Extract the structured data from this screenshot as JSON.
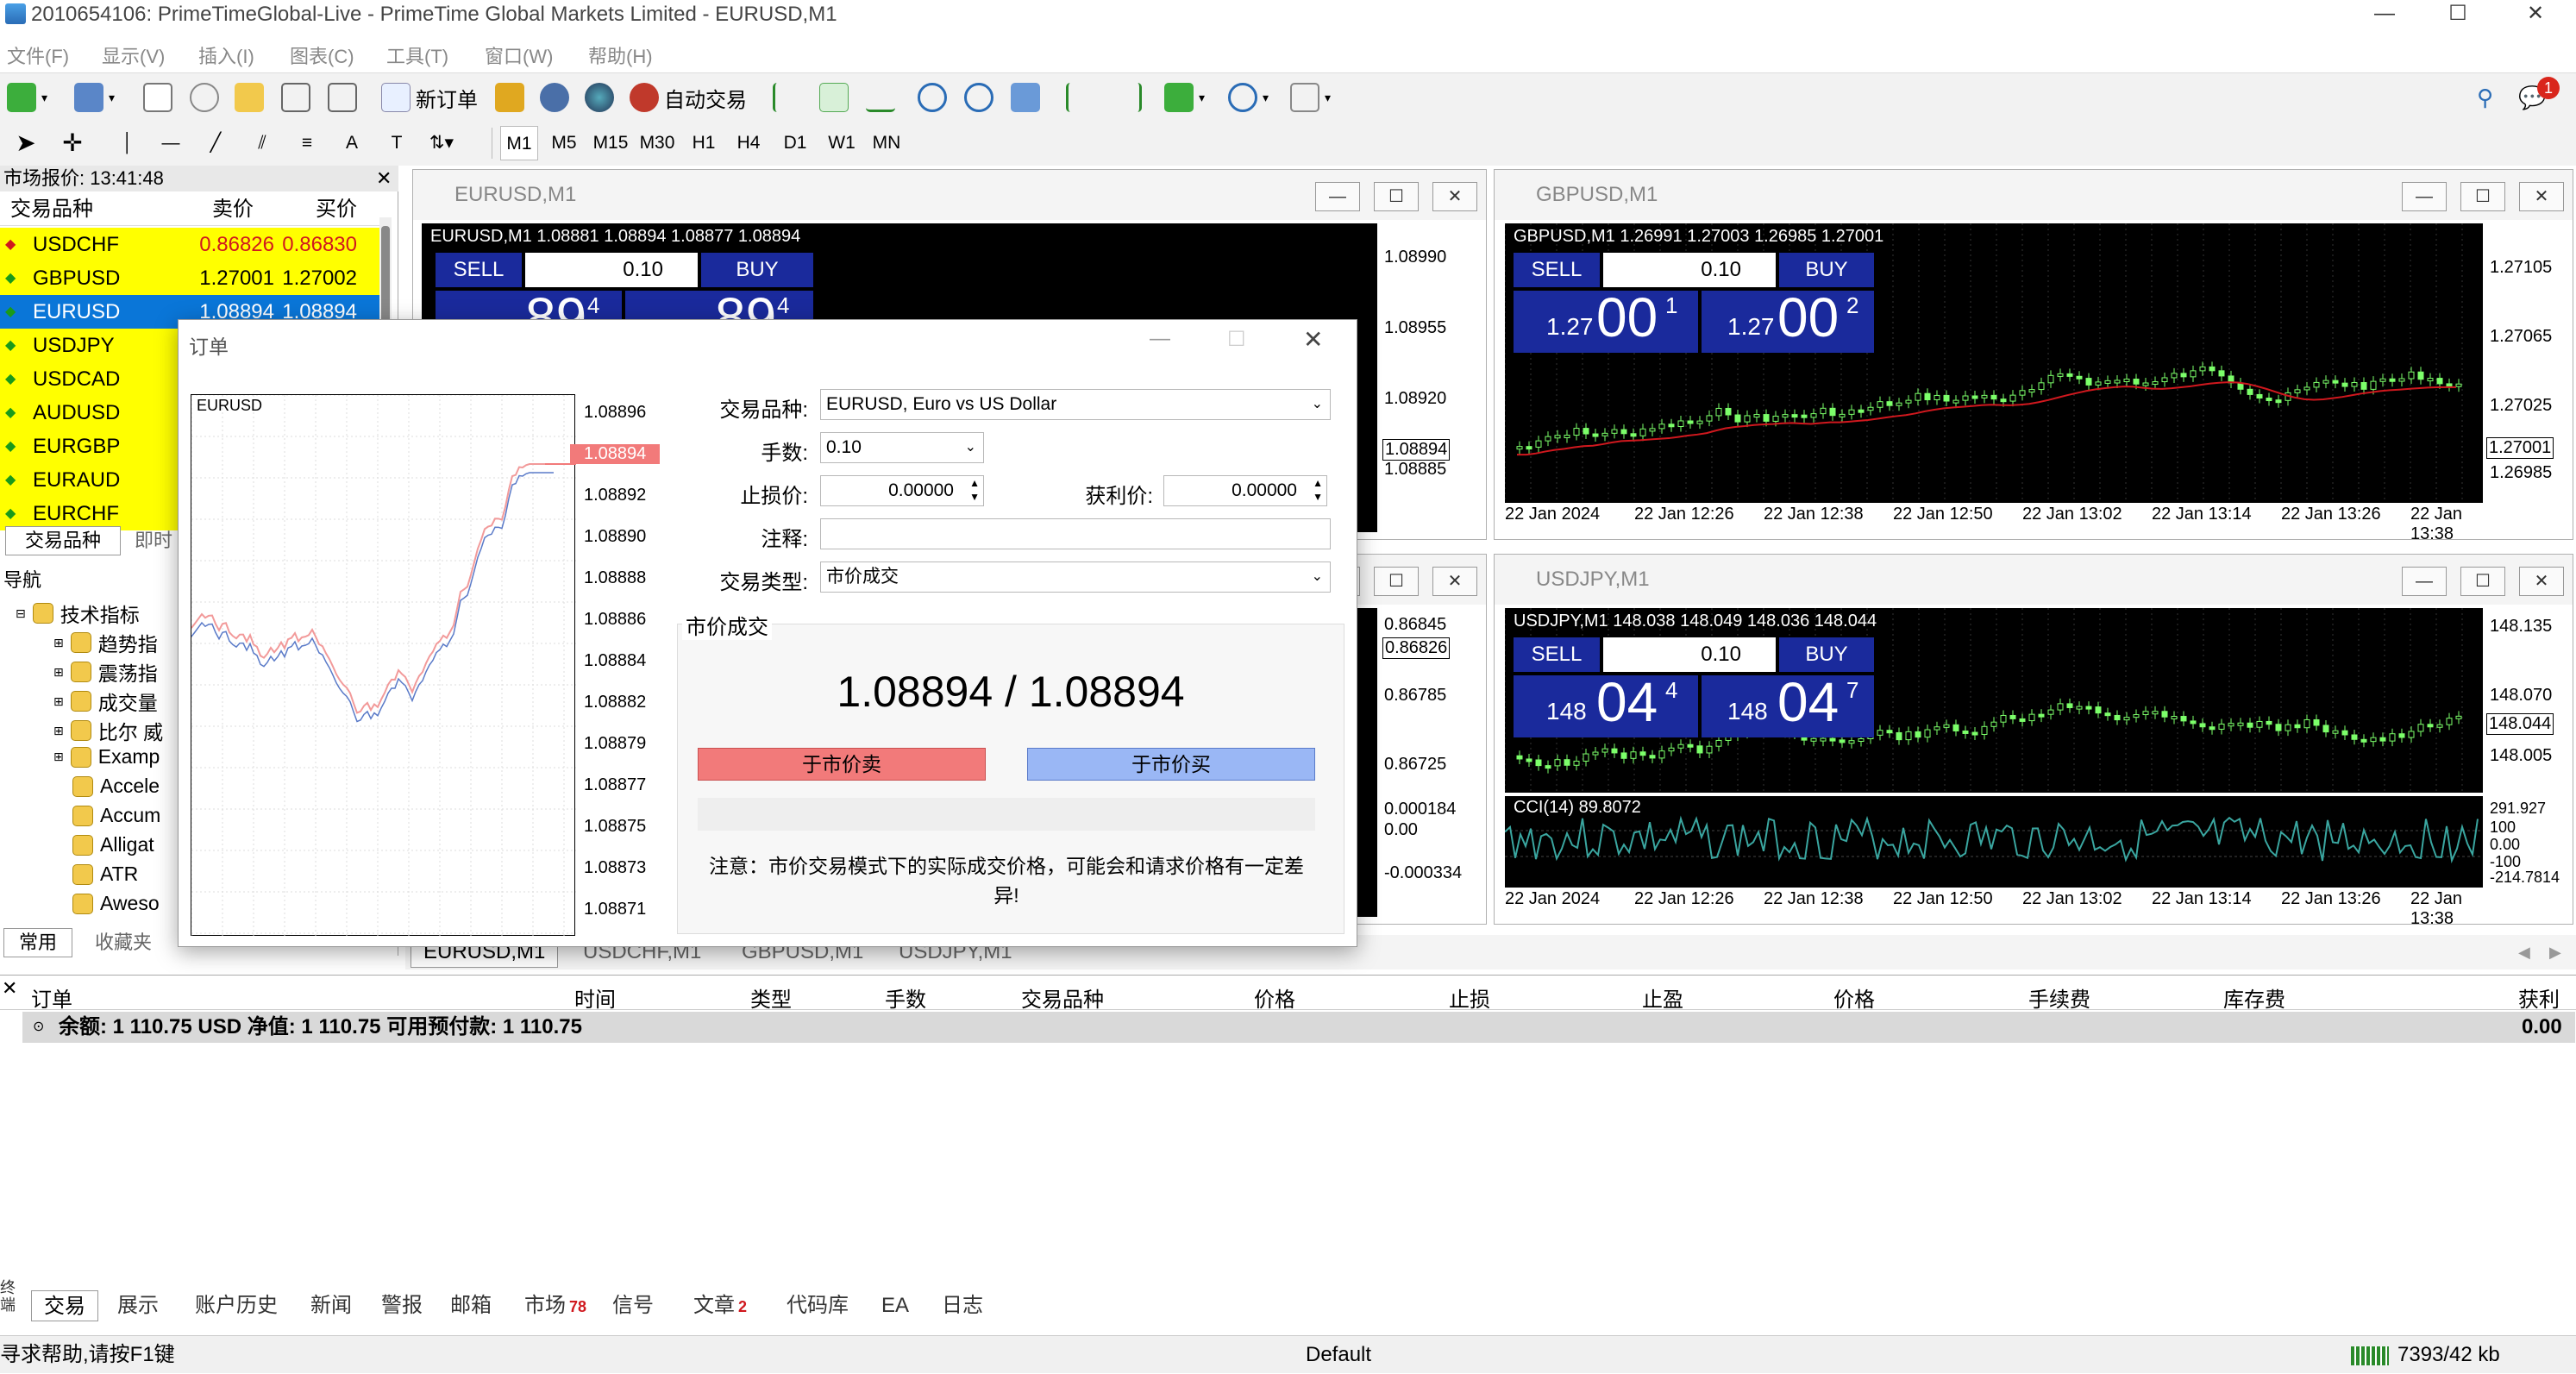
{
  "window": {
    "title": "2010654106: PrimeTimeGlobal-Live - PrimeTime Global Markets Limited - EURUSD,M1",
    "minimize": "—",
    "maximize": "☐",
    "close": "✕"
  },
  "menu": [
    "文件(F)",
    "显示(V)",
    "插入(I)",
    "图表(C)",
    "工具(T)",
    "窗口(W)",
    "帮助(H)"
  ],
  "toolbar": {
    "new_order": "新订单",
    "auto_trade": "自动交易",
    "timeframes": [
      "M1",
      "M5",
      "M15",
      "M30",
      "H1",
      "H4",
      "D1",
      "W1",
      "MN"
    ],
    "notif_count": "1"
  },
  "market_watch": {
    "title": "市场报价: 13:41:48",
    "col_symbol": "交易品种",
    "col_bid": "卖价",
    "col_ask": "买价",
    "rows": [
      {
        "symbol": "USDCHF",
        "bid": "0.86826",
        "ask": "0.86830"
      },
      {
        "symbol": "GBPUSD",
        "bid": "1.27001",
        "ask": "1.27002"
      },
      {
        "symbol": "EURUSD",
        "bid": "1.08894",
        "ask": "1.08894"
      },
      {
        "symbol": "USDJPY",
        "bid": "",
        "ask": ""
      },
      {
        "symbol": "USDCAD",
        "bid": "",
        "ask": ""
      },
      {
        "symbol": "AUDUSD",
        "bid": "",
        "ask": ""
      },
      {
        "symbol": "EURGBP",
        "bid": "",
        "ask": ""
      },
      {
        "symbol": "EURAUD",
        "bid": "",
        "ask": ""
      },
      {
        "symbol": "EURCHF",
        "bid": "",
        "ask": ""
      }
    ],
    "tab1": "交易品种",
    "tab2": "即时"
  },
  "navigator": {
    "title": "导航",
    "root": "技术指标",
    "items": [
      "趋势指",
      "震荡指",
      "成交量",
      "比尔 威",
      "Examp",
      "Accele",
      "Accum",
      "Alligat",
      "ATR",
      "Aweso"
    ],
    "tab1": "常用",
    "tab2": "收藏夹"
  },
  "charts": {
    "eurusd": {
      "caption": "EURUSD,M1",
      "ohlc": "EURUSD,M1  1.08881 1.08894 1.08877 1.08894",
      "sell": "SELL",
      "buy": "BUY",
      "lot": "0.10",
      "big_sell": "89",
      "big_sell_sup": "4",
      "big_buy": "89",
      "big_buy_sup": "4",
      "axis": [
        "1.08990",
        "1.08955",
        "1.08920",
        "1.08894",
        "1.08885"
      ]
    },
    "gbpusd": {
      "caption": "GBPUSD,M1",
      "ohlc": "GBPUSD,M1  1.26991 1.27003 1.26985 1.27001",
      "sell": "SELL",
      "buy": "BUY",
      "lot": "0.10",
      "sell_small": "1.27",
      "sell_big": "00",
      "sell_sup": "1",
      "buy_small": "1.27",
      "buy_big": "00",
      "buy_sup": "2",
      "axis": [
        "1.27105",
        "1.27065",
        "1.27025",
        "1.27001",
        "1.26985"
      ],
      "times": [
        "22 Jan 2024",
        "22 Jan 12:26",
        "22 Jan 12:38",
        "22 Jan 12:50",
        "22 Jan 13:02",
        "22 Jan 13:14",
        "22 Jan 13:26",
        "22 Jan 13:38"
      ]
    },
    "usdchf": {
      "axis": [
        "0.86845",
        "0.86826",
        "0.86785",
        "0.86725",
        "0.000184",
        "0.00",
        "-0.000334"
      ]
    },
    "usdjpy": {
      "caption": "USDJPY,M1",
      "ohlc": "USDJPY,M1  148.038 148.049 148.036 148.044",
      "sell": "SELL",
      "buy": "BUY",
      "lot": "0.10",
      "sell_small": "148",
      "sell_big": "04",
      "sell_sup": "4",
      "buy_small": "148",
      "buy_big": "04",
      "buy_sup": "7",
      "axis": [
        "148.135",
        "148.070",
        "148.044",
        "148.005"
      ],
      "cci_label": "CCI(14) 89.8072",
      "cci_axis": [
        "291.927",
        "100",
        "0.00",
        "-100",
        "-214.7814"
      ],
      "times": [
        "22 Jan 2024",
        "22 Jan 12:26",
        "22 Jan 12:38",
        "22 Jan 12:50",
        "22 Jan 13:02",
        "22 Jan 13:14",
        "22 Jan 13:26",
        "22 Jan 13:38"
      ]
    }
  },
  "chart_tabs": [
    "EURUSD,M1",
    "USDCHF,M1",
    "GBPUSD,M1",
    "USDJPY,M1"
  ],
  "order_dialog": {
    "title": "订单",
    "mini_symbol": "EURUSD",
    "mini_axis": [
      "1.08896",
      "1.08894",
      "1.08892",
      "1.08890",
      "1.08888",
      "1.08886",
      "1.08884",
      "1.08882",
      "1.08879",
      "1.08877",
      "1.08875",
      "1.08873",
      "1.08871"
    ],
    "symbol_label": "交易品种:",
    "symbol_value": "EURUSD, Euro vs US Dollar",
    "volume_label": "手数:",
    "volume_value": "0.10",
    "sl_label": "止损价:",
    "sl_value": "0.00000",
    "tp_label": "获利价:",
    "tp_value": "0.00000",
    "comment_label": "注释:",
    "comment_value": "",
    "type_label": "交易类型:",
    "type_value": "市价成交",
    "group_label": "市价成交",
    "price_display": "1.08894 / 1.08894",
    "sell_btn": "于市价卖",
    "buy_btn": "于市价买",
    "note": "注意：市价交易模式下的实际成交价格，可能会和请求价格有一定差异!"
  },
  "terminal": {
    "headers": [
      "订单",
      "时间",
      "类型",
      "手数",
      "交易品种",
      "价格",
      "止损",
      "止盈",
      "价格",
      "手续费",
      "库存费",
      "获利"
    ],
    "balance_line": "余额: 1 110.75 USD  净值: 1 110.75  可用预付款: 1 110.75",
    "balance_profit": "0.00",
    "side_label": "终端",
    "tabs": [
      "交易",
      "展示",
      "账户历史",
      "新闻",
      "警报",
      "邮箱",
      "市场",
      "信号",
      "文章",
      "代码库",
      "EA",
      "日志"
    ],
    "market_badge": "78",
    "article_badge": "2"
  },
  "status": {
    "help": "寻求帮助,请按F1键",
    "profile": "Default",
    "traffic": "7393/42 kb"
  },
  "colors": {
    "quote_yellow": "#ffff00",
    "select_blue": "#0a76d8",
    "sell_red": "#f27a7a",
    "buy_blue": "#9ab7f5",
    "panel_blue": "#1a2a9c",
    "candle_green": "#7cff6a",
    "ma_red": "#d0181e",
    "cci_teal": "#3aa6a0"
  }
}
